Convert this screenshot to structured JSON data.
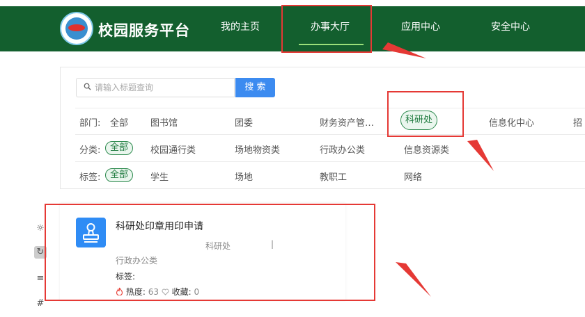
{
  "header": {
    "site_title": "校园服务平台",
    "nav": [
      {
        "label": "我的主页"
      },
      {
        "label": "办事大厅"
      },
      {
        "label": "应用中心"
      },
      {
        "label": "安全中心"
      }
    ],
    "active_nav": "办事大厅",
    "bg_color": "#135f2e"
  },
  "search": {
    "placeholder": "请输入标题查询",
    "button_label": "搜 索"
  },
  "filters": {
    "department": {
      "label": "部门:",
      "items": [
        "全部",
        "图书馆",
        "团委",
        "财务资产管…",
        "科研处",
        "信息化中心",
        "招"
      ],
      "selected": "科研处"
    },
    "category": {
      "label": "分类:",
      "items": [
        "全部",
        "校园通行类",
        "场地物资类",
        "行政办公类",
        "信息资源类"
      ],
      "selected": "全部"
    },
    "tag": {
      "label": "标签:",
      "items": [
        "全部",
        "学生",
        "场地",
        "教职工",
        "网络"
      ],
      "selected": "全部"
    }
  },
  "service_card": {
    "title": "科研处印章用印申请",
    "department": "科研处",
    "separator": "|",
    "category": "行政办公类",
    "tags_label": "标签:",
    "heat_label": "热度:",
    "heat_value": "63",
    "fav_label": "收藏:",
    "fav_value": "0",
    "icon": "stamp-icon"
  },
  "sidebar_tools": [
    "sun-icon",
    "refresh-icon",
    "list-icon",
    "hash-icon"
  ],
  "accent_color": "#e53935"
}
